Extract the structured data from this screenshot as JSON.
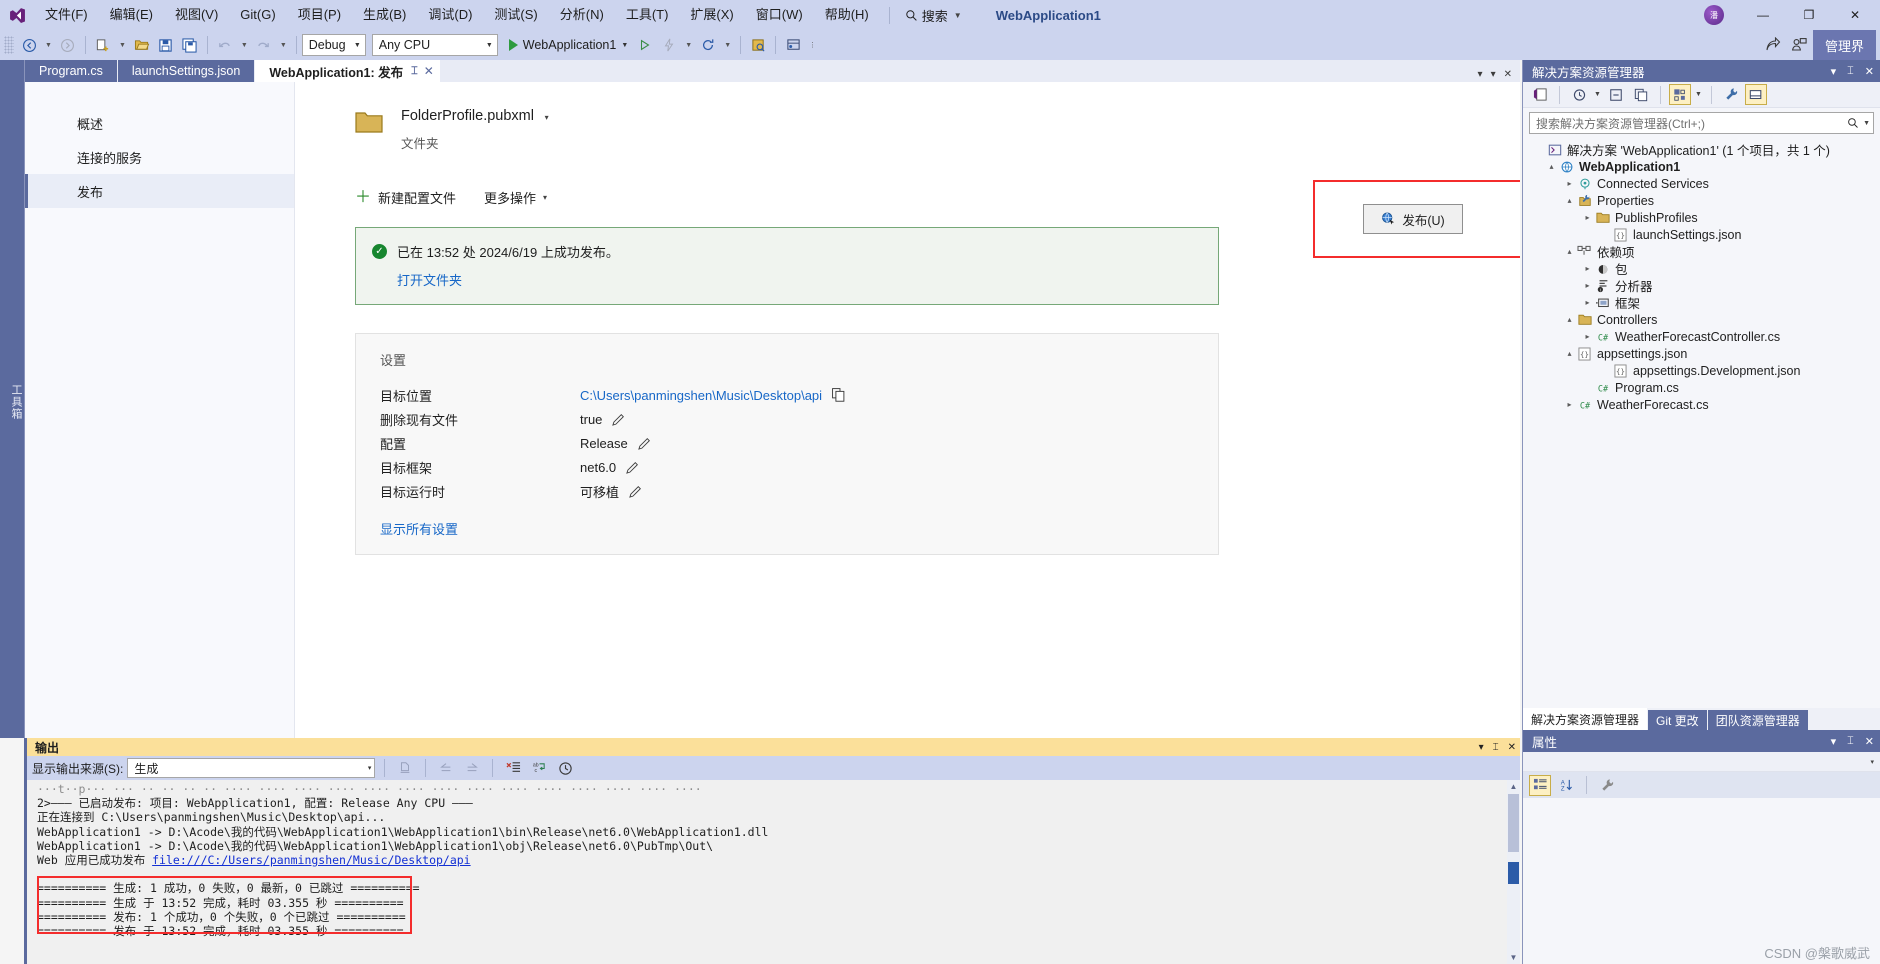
{
  "titlebar": {
    "logo_icon": "visual-studio-logo",
    "menus": [
      "文件(F)",
      "编辑(E)",
      "视图(V)",
      "Git(G)",
      "项目(P)",
      "生成(B)",
      "调试(D)",
      "测试(S)",
      "分析(N)",
      "工具(T)",
      "扩展(X)",
      "窗口(W)",
      "帮助(H)"
    ],
    "search_icon": "search-icon",
    "search_label": "搜索",
    "app_title": "WebApplication1",
    "avatar_text": "潘",
    "minimize": "—",
    "restore": "❐",
    "close": "✕"
  },
  "toolbar": {
    "nav_back_icon": "navigate-back-icon",
    "nav_forward_icon": "navigate-forward-icon",
    "new_item_icon": "new-item-icon",
    "open_file_icon": "open-file-icon",
    "save_icon": "save-icon",
    "save_all_icon": "save-all-icon",
    "undo_icon": "undo-icon",
    "redo_icon": "redo-icon",
    "configuration": "Debug",
    "platform": "Any CPU",
    "start_label": "WebApplication1",
    "start_icon": "start-debug-icon",
    "attach_icon": "attach-process-icon",
    "hot_reload_icon": "hot-reload-icon",
    "live_share_icon": "live-share-icon",
    "select_box_icon": "selection-icon",
    "layout_icon": "window-layout-icon",
    "overflow_icon": "toolbar-overflow-icon",
    "feedback_icon": "feedback-icon",
    "share_icon": "share-icon",
    "manage_label": "管理界"
  },
  "left_rail": {
    "label": "工具箱"
  },
  "tabs": [
    {
      "label": "Program.cs",
      "active": false
    },
    {
      "label": "launchSettings.json",
      "active": false
    },
    {
      "label": "WebApplication1: 发布",
      "active": true
    }
  ],
  "tab_controls": {
    "pin": "⌶",
    "close": "✕",
    "list_caret": "▾",
    "menu": "▾",
    "close_all": "✕"
  },
  "publish": {
    "nav": [
      {
        "label": "概述",
        "active": false
      },
      {
        "label": "连接的服务",
        "active": false
      },
      {
        "label": "发布",
        "active": true
      }
    ],
    "folder_icon": "folder-icon",
    "profile_name": "FolderProfile.pubxml",
    "profile_caret": "▾",
    "profile_type": "文件夹",
    "publish_button": {
      "label": "发布(U)",
      "icon": "publish-globe-icon"
    },
    "new_profile": {
      "label": "新建配置文件",
      "icon": "plus-icon"
    },
    "more_actions": {
      "label": "更多操作",
      "caret": "▾"
    },
    "status": {
      "icon": "success-check-icon",
      "message": "已在 13:52 处 2024/6/19 上成功发布。",
      "link": "打开文件夹"
    },
    "settings_title": "设置",
    "settings_rows": [
      {
        "key": "目标位置",
        "value": "C:\\Users\\panmingshen\\Music\\Desktop\\api",
        "is_link": true,
        "action_icon": "copy-icon"
      },
      {
        "key": "删除现有文件",
        "value": "true",
        "is_link": false,
        "action_icon": "pencil-icon"
      },
      {
        "key": "配置",
        "value": "Release",
        "is_link": false,
        "action_icon": "pencil-icon"
      },
      {
        "key": "目标框架",
        "value": "net6.0",
        "is_link": false,
        "action_icon": "pencil-icon"
      },
      {
        "key": "目标运行时",
        "value": "可移植",
        "is_link": false,
        "action_icon": "pencil-icon"
      }
    ],
    "show_all_link": "显示所有设置"
  },
  "solution_explorer": {
    "title": "解决方案资源管理器",
    "header_icons": {
      "dropdown": "▾",
      "pin": "⌶",
      "close": "✕"
    },
    "toolbar_icons": [
      "code-view-icon",
      "pending-changes-icon",
      "collapse-all-icon",
      "copy-icon",
      "show-all-files-icon",
      "properties-wrench-icon",
      "preview-pane-icon"
    ],
    "search_placeholder": "搜索解决方案资源管理器(Ctrl+;)",
    "search_icon": "search-icon",
    "tree": [
      {
        "label": "解决方案 'WebApplication1' (1 个项目，共 1 个)",
        "indent": 0,
        "expander": "",
        "icon": "solution-icon",
        "bold": false
      },
      {
        "label": "WebApplication1",
        "indent": 1,
        "expander": "▴",
        "icon": "web-project-icon",
        "bold": true
      },
      {
        "label": "Connected Services",
        "indent": 2,
        "expander": "▸",
        "icon": "connected-services-icon",
        "bold": false
      },
      {
        "label": "Properties",
        "indent": 2,
        "expander": "▴",
        "icon": "properties-icon",
        "bold": false
      },
      {
        "label": "PublishProfiles",
        "indent": 3,
        "expander": "▸",
        "icon": "folder-icon",
        "bold": false
      },
      {
        "label": "launchSettings.json",
        "indent": 4,
        "expander": "",
        "icon": "json-file-icon",
        "bold": false
      },
      {
        "label": "依赖项",
        "indent": 2,
        "expander": "▴",
        "icon": "dependencies-icon",
        "bold": false
      },
      {
        "label": "包",
        "indent": 3,
        "expander": "▸",
        "icon": "package-icon",
        "bold": false
      },
      {
        "label": "分析器",
        "indent": 3,
        "expander": "▸",
        "icon": "analyzer-icon",
        "bold": false
      },
      {
        "label": "框架",
        "indent": 3,
        "expander": "▸",
        "icon": "framework-icon",
        "bold": false
      },
      {
        "label": "Controllers",
        "indent": 2,
        "expander": "▴",
        "icon": "folder-icon",
        "bold": false
      },
      {
        "label": "WeatherForecastController.cs",
        "indent": 3,
        "expander": "▸",
        "icon": "csharp-file-icon",
        "bold": false
      },
      {
        "label": "appsettings.json",
        "indent": 2,
        "expander": "▴",
        "icon": "json-file-icon",
        "bold": false
      },
      {
        "label": "appsettings.Development.json",
        "indent": 4,
        "expander": "",
        "icon": "json-file-icon",
        "bold": false
      },
      {
        "label": "Program.cs",
        "indent": 3,
        "expander": "",
        "icon": "csharp-file-icon",
        "bold": false
      },
      {
        "label": "WeatherForecast.cs",
        "indent": 2,
        "expander": "▸",
        "icon": "csharp-file-icon",
        "bold": false
      }
    ],
    "bottom_tabs": [
      {
        "label": "解决方案资源管理器",
        "active": true
      },
      {
        "label": "Git 更改",
        "active": false
      },
      {
        "label": "团队资源管理器",
        "active": false
      }
    ]
  },
  "properties_panel": {
    "title": "属性",
    "header_icons": {
      "dropdown": "▾",
      "pin": "⌶",
      "close": "✕"
    },
    "selector_caret": "▾",
    "toolbar_icons": [
      "categorized-icon",
      "alphabetical-icon",
      "property-pages-icon"
    ]
  },
  "output_panel": {
    "title": "输出",
    "header_icons": {
      "minimize": "▾",
      "pin": "⌶",
      "close": "✕"
    },
    "source_label": "显示输出来源(S):",
    "source_value": "生成",
    "source_caret": "▾",
    "toolbar_icons": [
      "find-message-icon",
      "go-to-previous-icon",
      "go-to-next-icon",
      "clear-all-icon",
      "word-wrap-icon",
      "show-timestamps-icon"
    ],
    "lines": [
      {
        "text": "2>——— 已启动发布: 项目: WebApplication1, 配置: Release Any CPU ———",
        "link": false
      },
      {
        "text": "正在连接到 C:\\Users\\panmingshen\\Music\\Desktop\\api...",
        "link": false
      },
      {
        "text": "WebApplication1 -> D:\\Acode\\我的代码\\WebApplication1\\WebApplication1\\bin\\Release\\net6.0\\WebApplication1.dll",
        "link": false
      },
      {
        "text": "WebApplication1 -> D:\\Acode\\我的代码\\WebApplication1\\WebApplication1\\obj\\Release\\net6.0\\PubTmp\\Out\\",
        "link": false
      },
      {
        "text": "Web 应用已成功发布 ",
        "link_text": "file:///C:/Users/panmingshen/Music/Desktop/api",
        "link": true
      }
    ],
    "summary_lines": [
      "========== 生成: 1 成功，0 失败，0 最新，0 已跳过 ==========",
      "========== 生成 于 13:52 完成，耗时 03.355 秒 ==========",
      "========== 发布: 1 个成功，0 个失败，0 个已跳过 ==========",
      "========== 发布 于 13:52 完成，耗时 03.355 秒 =========="
    ]
  },
  "watermark": "CSDN @槃歌威武",
  "colors": {
    "chrome": "#ccd4ee",
    "panel_header": "#5b6a9e",
    "accent_link": "#1767c7",
    "highlight_red": "#f42c2c",
    "output_header": "#fbe09a",
    "success_green": "#17862f"
  }
}
